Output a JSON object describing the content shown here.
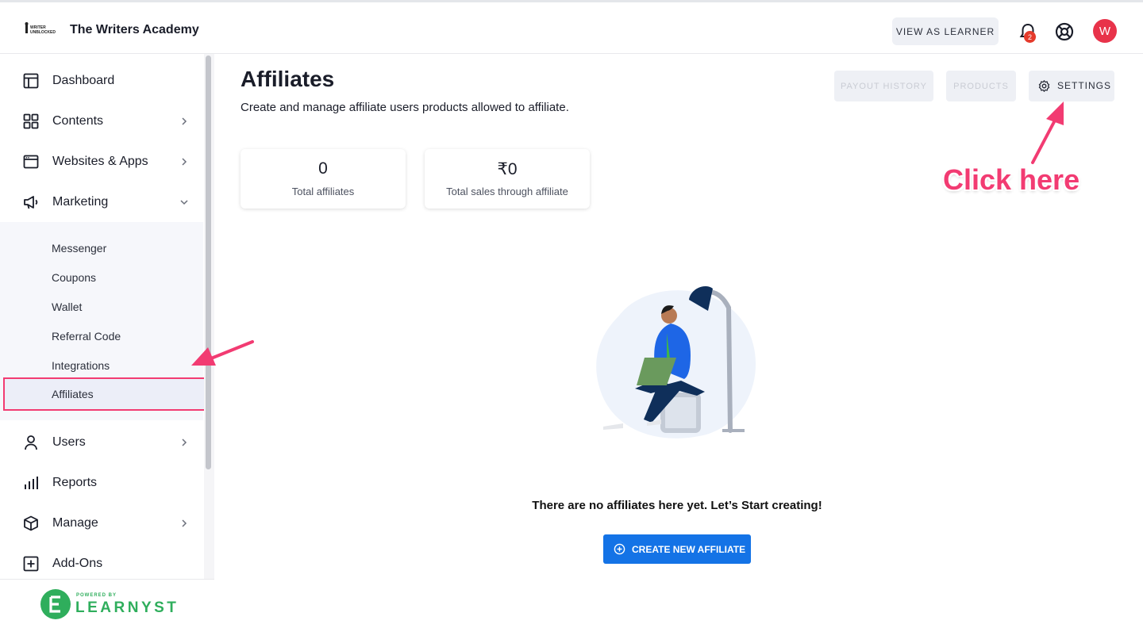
{
  "header": {
    "logo_text": "WRITER UNBLOCKED",
    "brand": "The Writers Academy",
    "view_as_learner": "VIEW AS LEARNER",
    "notification_count": "2",
    "avatar_initial": "W"
  },
  "sidebar": {
    "items_top": [
      {
        "label": "Dashboard",
        "icon": "layout-icon"
      },
      {
        "label": "Contents",
        "icon": "grid-icon"
      },
      {
        "label": "Websites & Apps",
        "icon": "browser-window-icon"
      },
      {
        "label": "Marketing",
        "icon": "megaphone-icon"
      }
    ],
    "sub_items": [
      {
        "label": "Messenger"
      },
      {
        "label": "Coupons"
      },
      {
        "label": "Wallet"
      },
      {
        "label": "Referral Code"
      },
      {
        "label": "Integrations"
      },
      {
        "label": "Affiliates",
        "active": true
      }
    ],
    "items_bottom": [
      {
        "label": "Users",
        "icon": "user-icon"
      },
      {
        "label": "Reports",
        "icon": "bar-chart-icon"
      },
      {
        "label": "Manage",
        "icon": "box-icon"
      },
      {
        "label": "Add-Ons",
        "icon": "plus-square-icon"
      }
    ],
    "powered_by": "POWERED BY",
    "powered_brand": "LEARNYST"
  },
  "main": {
    "title": "Affiliates",
    "subtitle": "Create and manage affiliate users products allowed to affiliate.",
    "buttons": {
      "payout_history": "PAYOUT HISTORY",
      "products": "PRODUCTS",
      "settings": "SETTINGS"
    },
    "stats": [
      {
        "value": "0",
        "label": "Total affiliates"
      },
      {
        "value": "₹0",
        "label": "Total sales through affiliate"
      }
    ],
    "empty_message": "There are no affiliates here yet. Let’s Start creating!",
    "create_button": "CREATE NEW AFFILIATE"
  },
  "annotation": {
    "callout": "Click here",
    "accent_color": "#f23b72"
  }
}
